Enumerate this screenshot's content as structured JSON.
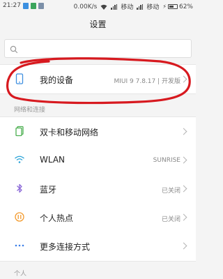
{
  "status_bar": {
    "time": "21:27",
    "speed": "0.00K/s",
    "carrier1": "移动",
    "carrier2": "移动",
    "battery": "62%",
    "battery_level": 0.62
  },
  "header": {
    "title": "设置"
  },
  "search": {
    "placeholder": ""
  },
  "my_device": {
    "label": "我的设备",
    "value": "MIUI 9 7.8.17 | 开发版"
  },
  "sections": {
    "network": "网络和连接",
    "personal": "个人"
  },
  "network_items": [
    {
      "label": "双卡和移动网络",
      "value": "",
      "icon": "sim-card-icon"
    },
    {
      "label": "WLAN",
      "value": "SUNRISE",
      "icon": "wifi-icon"
    },
    {
      "label": "蓝牙",
      "value": "已关闭",
      "icon": "bluetooth-icon"
    },
    {
      "label": "个人热点",
      "value": "已关闭",
      "icon": "hotspot-icon"
    },
    {
      "label": "更多连接方式",
      "value": "",
      "icon": "more-dots-icon"
    }
  ],
  "colors": {
    "annotation": "#d7191f",
    "sim": "#4caf50",
    "wifi": "#2aa3d8",
    "bluetooth": "#8c6ad8",
    "hotspot": "#f39a2c",
    "more": "#3d7fe8"
  }
}
